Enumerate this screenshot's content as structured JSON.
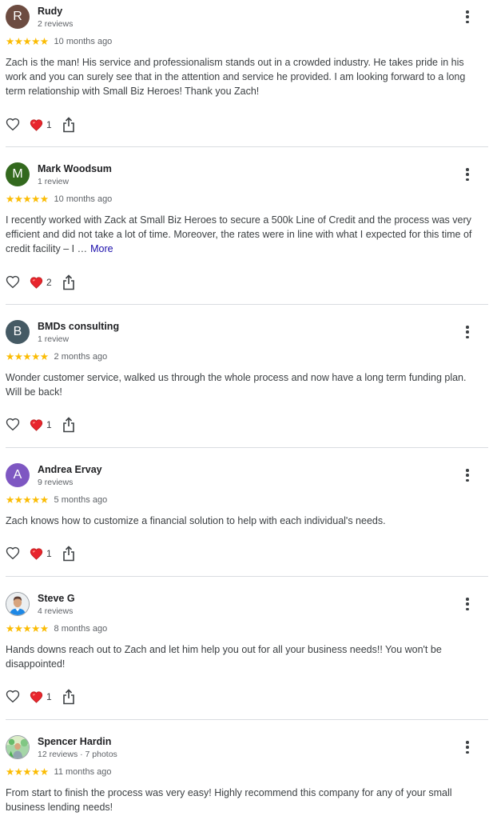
{
  "colors": {
    "star": "#fbbc04",
    "link": "#1a0dab",
    "divider": "#dadce0",
    "heart": "#e8252d"
  },
  "icons": {
    "star": "star-icon",
    "like": "heart-outline-icon",
    "reaction": "red-heart-icon",
    "share": "share-icon",
    "menu": "more-vert-icon"
  },
  "reviews": [
    {
      "initial": "R",
      "avatar_color": "#6d4c41",
      "name": "Rudy",
      "meta": "2 reviews",
      "stars": "★★★★★",
      "rating": 5,
      "time": "10 months ago",
      "text": "Zach is the man! His service and professionalism stands out in a crowded industry. He takes pride in his work and you can surely see that in the attention and service he provided. I am looking forward to a long term relationship with Small Biz Heroes! Thank you Zach!",
      "more": "",
      "reactions": "1"
    },
    {
      "initial": "M",
      "avatar_color": "#33691e",
      "name": "Mark Woodsum",
      "meta": "1 review",
      "stars": "★★★★★",
      "rating": 5,
      "time": "10 months ago",
      "text": "I recently worked with Zack at Small Biz Heroes to secure a 500k Line of Credit and the process was very efficient and did not take a lot of time. Moreover, the rates were in line with what I expected for this time of credit facility – I …",
      "more": "More",
      "reactions": "2"
    },
    {
      "initial": "B",
      "avatar_color": "#455a64",
      "name": "BMDs consulting",
      "meta": "1 review",
      "stars": "★★★★★",
      "rating": 5,
      "time": "2 months ago",
      "text": "Wonder customer service, walked us through the whole process and now have a long term funding plan. Will be back!",
      "more": "",
      "reactions": "1"
    },
    {
      "initial": "A",
      "avatar_color": "#7e57c2",
      "name": "Andrea Ervay",
      "meta": "9 reviews",
      "stars": "★★★★★",
      "rating": 5,
      "time": "5 months ago",
      "text": "Zach knows how to customize a financial solution to help with each individual's needs.",
      "more": "",
      "reactions": "1"
    },
    {
      "initial": "",
      "avatar_color": "#e8eaed",
      "name": "Steve G",
      "meta": "4 reviews",
      "stars": "★★★★★",
      "rating": 5,
      "time": "8 months ago",
      "text": "Hands downs reach out to Zach and let him help you out for all your business needs!! You won't be disappointed!",
      "more": "",
      "reactions": "1"
    },
    {
      "initial": "",
      "avatar_color": "#c8e6c9",
      "name": "Spencer Hardin",
      "meta": "12 reviews · 7 photos",
      "stars": "★★★★★",
      "rating": 5,
      "time": "11 months ago",
      "text": "From start to finish the process was very easy! Highly recommend this company for any of your small business lending needs!",
      "more": "",
      "reactions": ""
    }
  ]
}
